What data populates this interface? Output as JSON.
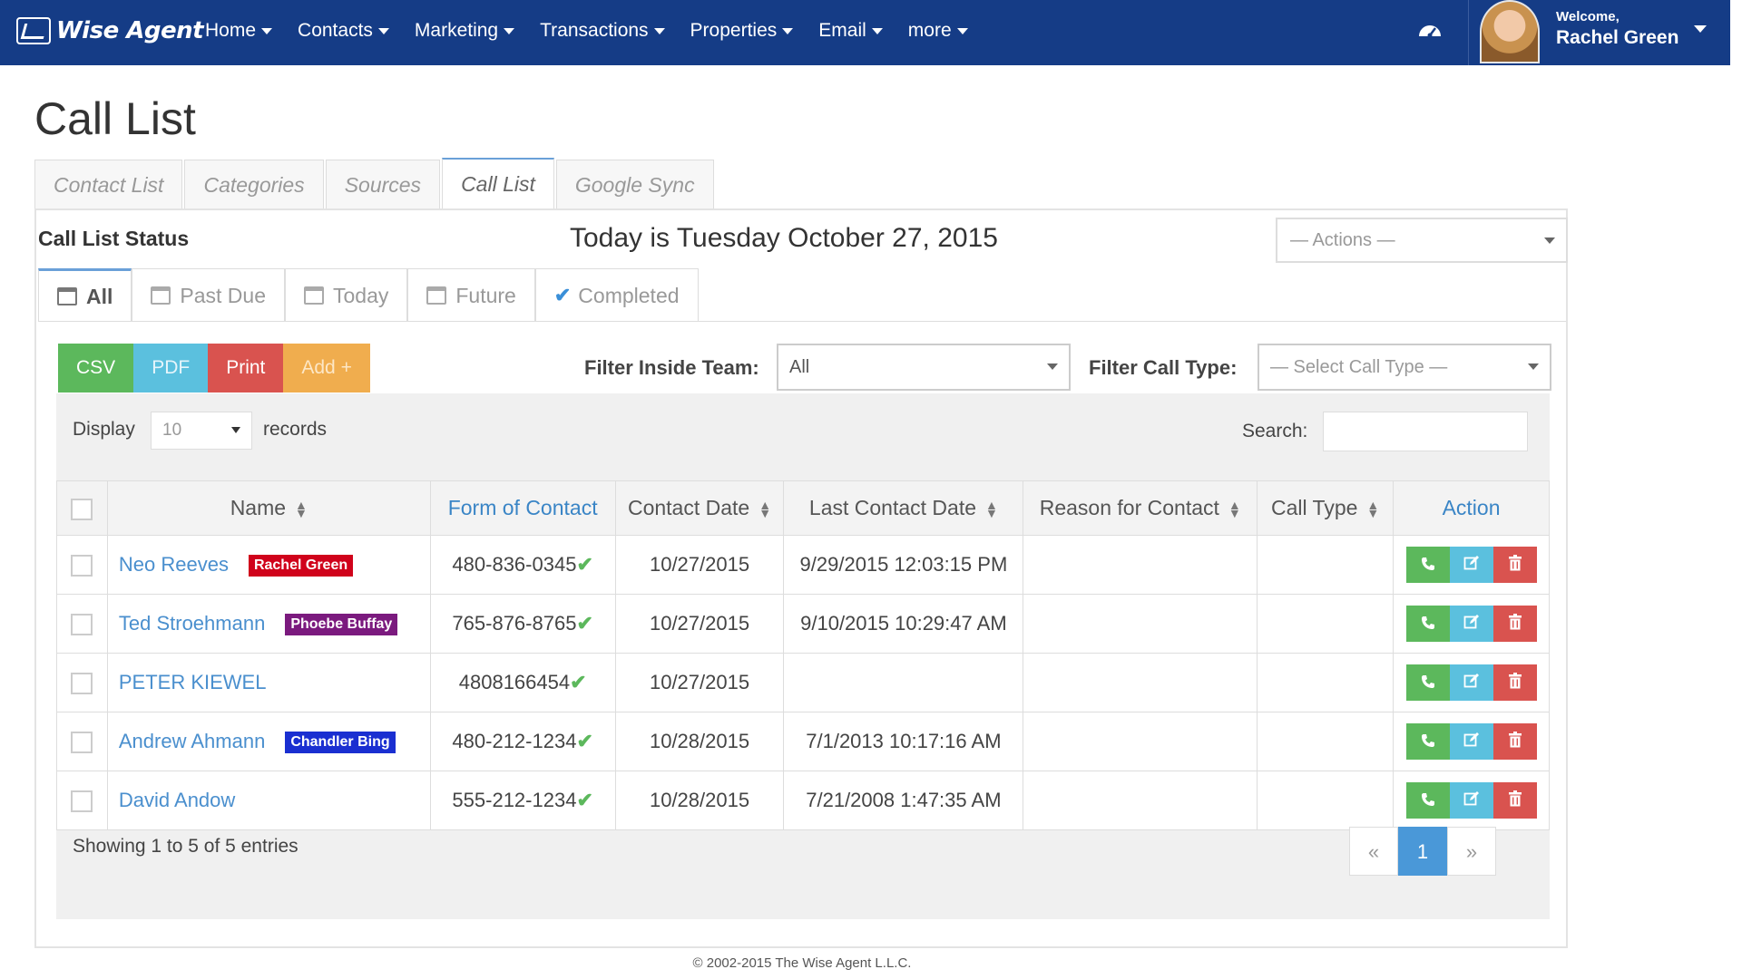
{
  "app": {
    "logo_text": "Wise Agent"
  },
  "nav": {
    "items": [
      {
        "label": "Home"
      },
      {
        "label": "Contacts"
      },
      {
        "label": "Marketing"
      },
      {
        "label": "Transactions"
      },
      {
        "label": "Properties"
      },
      {
        "label": "Email"
      },
      {
        "label": "more"
      }
    ]
  },
  "user": {
    "welcome": "Welcome,",
    "name": "Rachel Green"
  },
  "page": {
    "title": "Call List"
  },
  "main_tabs": [
    {
      "label": "Contact List"
    },
    {
      "label": "Categories"
    },
    {
      "label": "Sources"
    },
    {
      "label": "Call List",
      "active": true
    },
    {
      "label": "Google Sync"
    }
  ],
  "status": {
    "label": "Call List Status",
    "today": "Today is Tuesday October 27, 2015",
    "actions_placeholder": "— Actions —"
  },
  "sub_tabs": [
    {
      "label": "All",
      "icon": "calendar-icon",
      "active": true
    },
    {
      "label": "Past Due",
      "icon": "calendar-icon"
    },
    {
      "label": "Today",
      "icon": "calendar-icon"
    },
    {
      "label": "Future",
      "icon": "calendar-icon"
    },
    {
      "label": "Completed",
      "icon": "check-icon"
    }
  ],
  "toolbar": {
    "csv": "CSV",
    "pdf": "PDF",
    "print": "Print",
    "add": "Add +",
    "filter_team_label": "Filter Inside Team:",
    "filter_team_value": "All",
    "filter_type_label": "Filter Call Type:",
    "filter_type_placeholder": "— Select Call Type —"
  },
  "table_controls": {
    "display_label": "Display",
    "display_value": "10",
    "records_label": "records",
    "search_label": "Search:"
  },
  "table": {
    "headers": {
      "name": "Name",
      "form_of_contact": "Form of Contact",
      "contact_date": "Contact Date",
      "last_contact_date": "Last Contact Date",
      "reason": "Reason for Contact",
      "call_type": "Call Type",
      "action": "Action"
    },
    "rows": [
      {
        "name": "Neo Reeves",
        "tag": "Rachel Green",
        "tag_color": "#d0021b",
        "phone": "480-836-0345",
        "contact_date": "10/27/2015",
        "last_contact": "9/29/2015 12:03:15 PM",
        "reason": "",
        "call_type": ""
      },
      {
        "name": "Ted Stroehmann",
        "tag": "Phoebe Buffay",
        "tag_color": "#7b1a7e",
        "phone": "765-876-8765",
        "contact_date": "10/27/2015",
        "last_contact": "9/10/2015 10:29:47 AM",
        "reason": "",
        "call_type": ""
      },
      {
        "name": "PETER KIEWEL",
        "tag": "",
        "tag_color": "",
        "phone": "4808166454",
        "contact_date": "10/27/2015",
        "last_contact": "",
        "reason": "",
        "call_type": ""
      },
      {
        "name": "Andrew Ahmann",
        "tag": "Chandler Bing",
        "tag_color": "#1a2fd1",
        "phone": "480-212-1234",
        "contact_date": "10/28/2015",
        "last_contact": "7/1/2013 10:17:16 AM",
        "reason": "",
        "call_type": ""
      },
      {
        "name": "David Andow",
        "tag": "",
        "tag_color": "",
        "phone": "555-212-1234",
        "contact_date": "10/28/2015",
        "last_contact": "7/21/2008 1:47:35 AM",
        "reason": "",
        "call_type": ""
      }
    ]
  },
  "pagination": {
    "showing": "Showing 1 to 5 of 5 entries",
    "prev": "«",
    "current": "1",
    "next": "»"
  },
  "footer": {
    "text": "© 2002-2015 The Wise Agent L.L.C."
  }
}
